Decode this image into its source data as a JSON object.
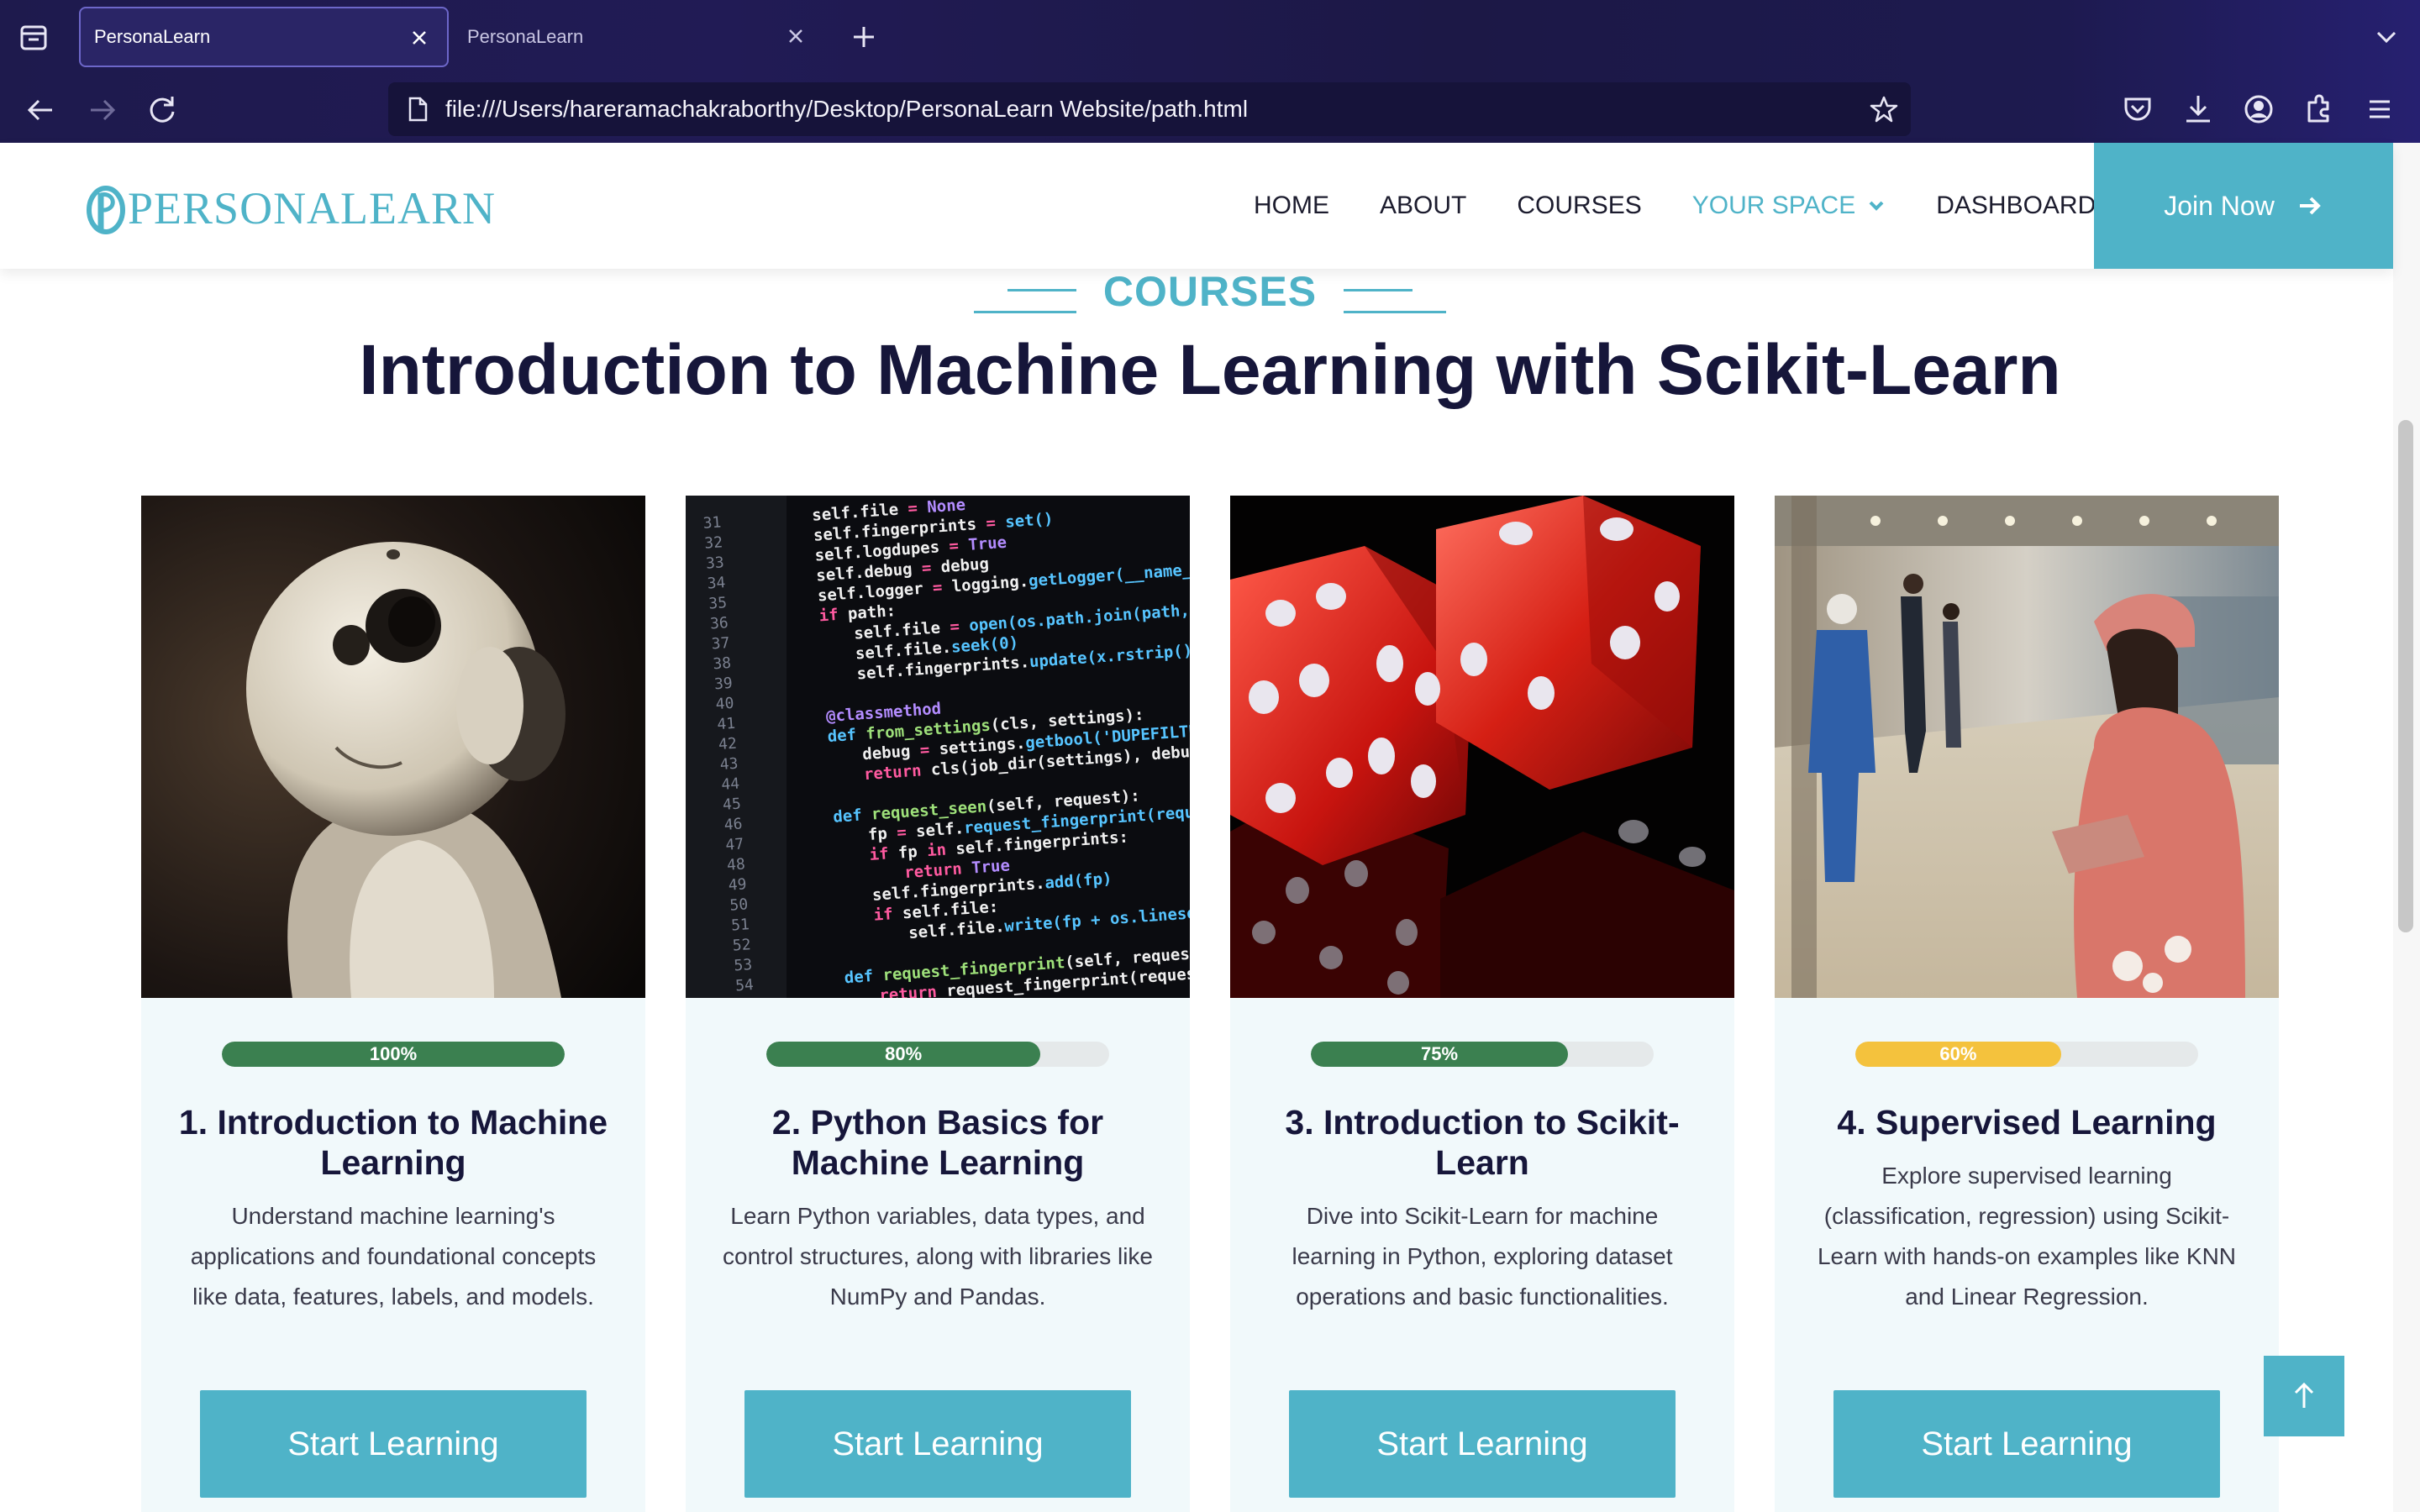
{
  "browser": {
    "tabs": [
      {
        "label": "PersonaLearn",
        "active": true
      },
      {
        "label": "PersonaLearn",
        "active": false
      }
    ],
    "url": "file:///Users/hareramachakraborthy/Desktop/PersonaLearn Website/path.html"
  },
  "header": {
    "logo_text": "PERSONALEARN",
    "menu": [
      "HOME",
      "ABOUT",
      "COURSES",
      "YOUR SPACE",
      "DASHBOARD"
    ],
    "active_menu": "YOUR SPACE",
    "join_label": "Join Now"
  },
  "main": {
    "section_tag": "COURSES",
    "title": "Introduction to Machine Learning with Scikit-Learn",
    "cards": [
      {
        "progress_label": "100%",
        "progress": 100,
        "progress_color": "#3b8050",
        "title": "1. Introduction to Machine Learning",
        "description": "Understand machine learning's applications and foundational concepts like data, features, labels, and models.",
        "button": "Start Learning",
        "image": "robot"
      },
      {
        "progress_label": "80%",
        "progress": 80,
        "progress_color": "#3b8050",
        "title": "2. Python Basics for Machine Learning",
        "description": "Learn Python variables, data types, and control structures, along with libraries like NumPy and Pandas.",
        "button": "Start Learning",
        "image": "code"
      },
      {
        "progress_label": "75%",
        "progress": 75,
        "progress_color": "#3b8050",
        "title": "3. Introduction to Scikit-Learn",
        "description": "Dive into Scikit-Learn for machine learning in Python, exploring dataset operations and basic functionalities.",
        "button": "Start Learning",
        "image": "dice"
      },
      {
        "progress_label": "60%",
        "progress": 60,
        "progress_color": "#f4c23d",
        "title": "4. Supervised Learning",
        "description": "Explore supervised learning (classification, regression) using Scikit-Learn with hands-on examples like KNN and Linear Regression.",
        "button": "Start Learning",
        "image": "station"
      }
    ]
  },
  "icons": {
    "scroll_top": "arrow-up-icon"
  }
}
